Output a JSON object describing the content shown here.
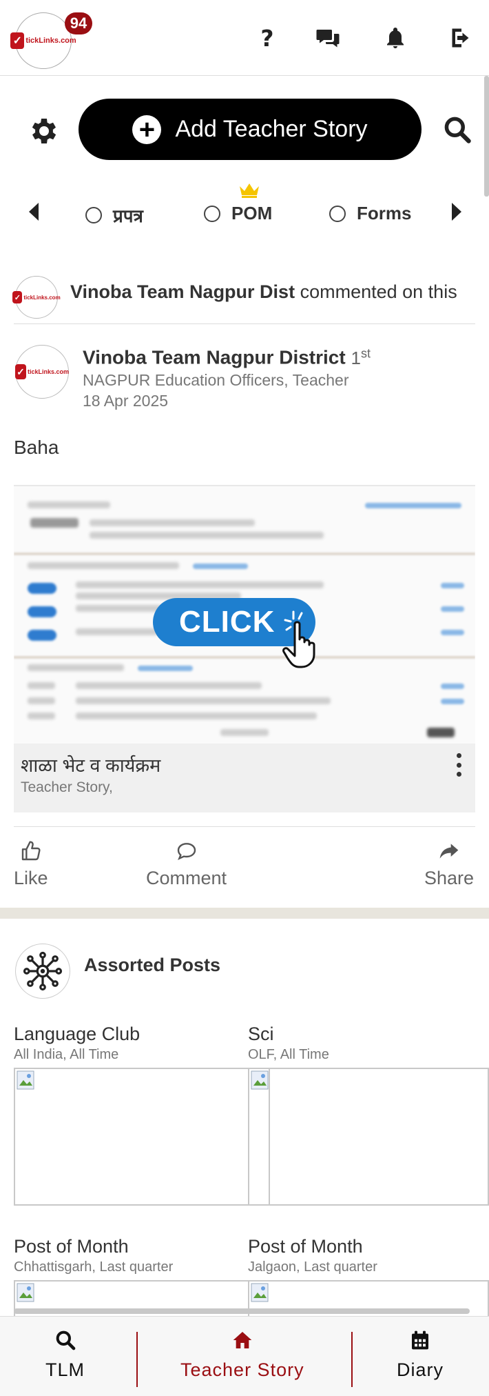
{
  "header": {
    "notification_count": "94",
    "logo_text": "tickLinks.com"
  },
  "toolbar": {
    "add_story_label": "Add Teacher Story"
  },
  "filters": {
    "options": [
      {
        "label": "प्रपत्र"
      },
      {
        "label": "POM"
      },
      {
        "label": "Forms"
      }
    ]
  },
  "activity": {
    "actor": "Vinoba Team Nagpur Dist",
    "action": "commented on this"
  },
  "post": {
    "author": "Vinoba Team Nagpur District",
    "rank": "1",
    "rank_suffix": "st",
    "role": "NAGPUR Education Officers, Teacher",
    "date": "18 Apr 2025",
    "text": "Baha",
    "image_button_text": "CLICK",
    "caption_title": "शाळा भेट व कार्यक्रम",
    "caption_sub": "Teacher Story,"
  },
  "actions": {
    "like": "Like",
    "comment": "Comment",
    "share": "Share"
  },
  "assorted": {
    "title": "Assorted Posts",
    "items": [
      {
        "title": "Language Club",
        "sub": "All India, All Time"
      },
      {
        "title": "Sci",
        "sub": "OLF, All Time"
      },
      {
        "title": "Post of Month",
        "sub": "Chhattisgarh, Last quarter"
      },
      {
        "title": "Post of Month",
        "sub": "Jalgaon, Last quarter"
      }
    ]
  },
  "bottom_nav": {
    "items": [
      {
        "label": "TLM",
        "color": "#111111"
      },
      {
        "label": "Teacher Story",
        "color": "#9a0e12"
      },
      {
        "label": "Diary",
        "color": "#111111"
      }
    ]
  },
  "colors": {
    "brand_red": "#c0141c",
    "accent_dark_red": "#9a0e12",
    "crown_gold": "#f5c400"
  }
}
